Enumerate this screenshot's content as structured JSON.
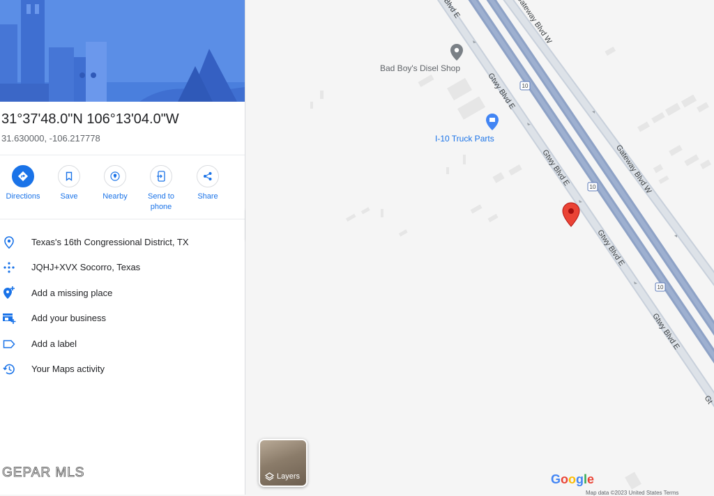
{
  "place": {
    "title": "31°37'48.0\"N 106°13'04.0\"W",
    "decimal": "31.630000, -106.217778"
  },
  "actions": [
    {
      "label": "Directions",
      "icon": "directions-icon"
    },
    {
      "label": "Save",
      "icon": "bookmark-icon"
    },
    {
      "label": "Nearby",
      "icon": "nearby-icon"
    },
    {
      "label": "Send to\nphone",
      "icon": "send-to-phone-icon"
    },
    {
      "label": "Share",
      "icon": "share-icon"
    }
  ],
  "info": [
    {
      "text": "Texas's 16th Congressional District, TX",
      "icon": "location-pin-icon"
    },
    {
      "text": "JQHJ+XVX Socorro, Texas",
      "icon": "plus-code-icon"
    },
    {
      "text": "Add a missing place",
      "icon": "add-place-icon"
    },
    {
      "text": "Add your business",
      "icon": "add-business-icon"
    },
    {
      "text": "Add a label",
      "icon": "label-icon"
    },
    {
      "text": "Your Maps activity",
      "icon": "history-icon"
    }
  ],
  "watermark": "GEPAR MLS",
  "map": {
    "pois": [
      {
        "name": "Bad Boy's Disel Shop",
        "color": "#5f6368"
      },
      {
        "name": "I-10 Truck Parts",
        "color": "#1a73e8"
      }
    ],
    "roads": {
      "gateway_w": "Gateway Blvd W",
      "gtwy_e": "Gtwy Blvd E",
      "blvd_e": "Blvd E",
      "gt": "Gt",
      "interstate": "10"
    },
    "layers_label": "Layers",
    "brand": "Google",
    "attribution": "Map data ©2023  United States  Terms"
  },
  "colors": {
    "accent": "#1a73e8",
    "hero_sky": "#5b8ee6",
    "hero_buildings": "#3f6fd1",
    "pin": "#ea4335",
    "highway": "#8ea2c6",
    "road": "#c8d0db"
  }
}
